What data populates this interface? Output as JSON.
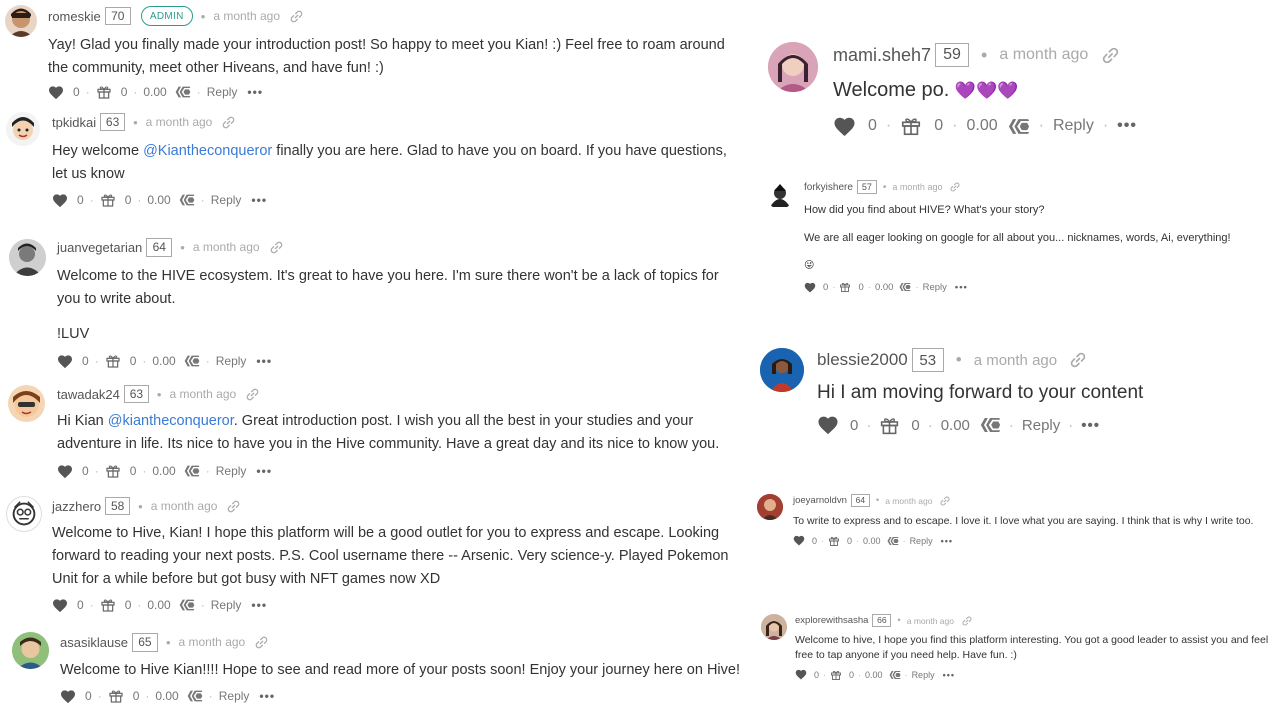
{
  "comments": [
    {
      "username": "romeskie",
      "rep": "70",
      "badge": "ADMIN",
      "time": "a month ago",
      "body1": "Yay! Glad you finally made your introduction post! So happy to meet you Kian! :) Feel free to roam around",
      "body2": "the community, meet other Hiveans, and have fun! :)",
      "votes": "0",
      "gifts": "0",
      "payout": "0.00",
      "reply": "Reply",
      "more": "•••"
    },
    {
      "username": "tpkidkai",
      "rep": "63",
      "time": "a month ago",
      "body_pre": "Hey welcome ",
      "mention": "@Kiantheconqueror",
      "body_post": " finally you are here. Glad to have you on board. If you have questions,",
      "body2": "let us know",
      "votes": "0",
      "gifts": "0",
      "payout": "0.00",
      "reply": "Reply",
      "more": "•••"
    },
    {
      "username": "juanvegetarian",
      "rep": "64",
      "time": "a month ago",
      "body1": "Welcome to the HIVE ecosystem. It's great to have you here. I'm sure there won't be a lack of topics for",
      "body2": "you to write about.",
      "body3": "!LUV",
      "votes": "0",
      "gifts": "0",
      "payout": "0.00",
      "reply": "Reply",
      "more": "•••"
    },
    {
      "username": "tawadak24",
      "rep": "63",
      "time": "a month ago",
      "body_pre": "Hi Kian ",
      "mention": "@kiantheconqueror",
      "body_post": ". Great introduction post. I wish you all the best in your studies and your",
      "body2": "adventure in life. Its nice to have you in the Hive community. Have a great day and its nice to know you.",
      "votes": "0",
      "gifts": "0",
      "payout": "0.00",
      "reply": "Reply",
      "more": "•••"
    },
    {
      "username": "jazzhero",
      "rep": "58",
      "time": "a month ago",
      "body1": "Welcome to Hive, Kian! I hope this platform will be a good outlet for you to express and escape. Looking",
      "body2": "forward to reading your next posts. P.S. Cool username there -- Arsenic. Very science-y. Played Pokemon",
      "body3": "Unit for a while before but got busy with NFT games now XD",
      "votes": "0",
      "gifts": "0",
      "payout": "0.00",
      "reply": "Reply",
      "more": "•••"
    },
    {
      "username": "asasiklause",
      "rep": "65",
      "time": "a month ago",
      "body1": "Welcome to Hive Kian!!!! Hope to see and read more of your posts soon! Enjoy your journey here on Hive!",
      "votes": "0",
      "gifts": "0",
      "payout": "0.00",
      "reply": "Reply",
      "more": "•••"
    },
    {
      "username": "mami.sheh7",
      "rep": "59",
      "time": "a month ago",
      "body1": "Welcome po.",
      "hearts": "💜💜💜",
      "votes": "0",
      "gifts": "0",
      "payout": "0.00",
      "reply": "Reply",
      "more": "•••"
    },
    {
      "username": "forkyishere",
      "rep": "57",
      "time": "a month ago",
      "body1": "How did you find about HIVE? What's your story?",
      "body2": "We are all eager looking on google for all about you... nicknames, words, Ai, everything!",
      "body3": "😜",
      "votes": "0",
      "gifts": "0",
      "payout": "0.00",
      "reply": "Reply",
      "more": "•••"
    },
    {
      "username": "blessie2000",
      "rep": "53",
      "time": "a month ago",
      "body1": "Hi I am moving forward to your content",
      "votes": "0",
      "gifts": "0",
      "payout": "0.00",
      "reply": "Reply",
      "more": "•••"
    },
    {
      "username": "joeyarnoldvn",
      "rep": "64",
      "time": "a month ago",
      "body1": "To write to express and to escape. I love it. I love what you are saying. I think that is why I write too.",
      "votes": "0",
      "gifts": "0",
      "payout": "0.00",
      "reply": "Reply",
      "more": "•••"
    },
    {
      "username": "explorewithsasha",
      "rep": "66",
      "time": "a month ago",
      "body1": "Welcome to hive, I hope you find this platform interesting. You got a good leader to assist you and feel",
      "body2": "free to tap anyone if you need help. Have fun. :)",
      "votes": "0",
      "gifts": "0",
      "payout": "0.00",
      "reply": "Reply",
      "more": "•••"
    }
  ]
}
